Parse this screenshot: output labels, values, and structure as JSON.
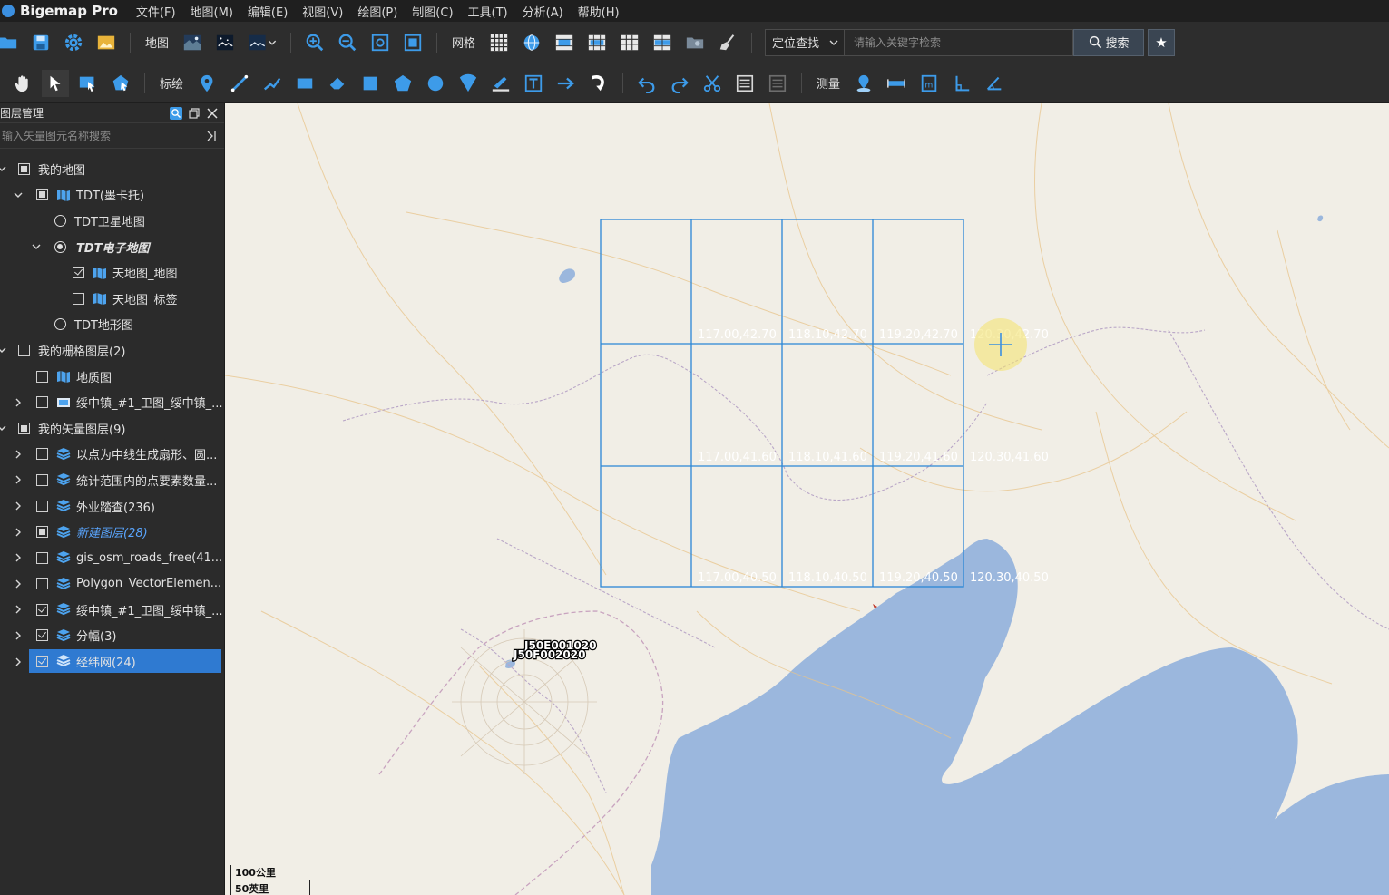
{
  "app": {
    "title": "Bigemap Pro",
    "menus": [
      "文件(F)",
      "地图(M)",
      "编辑(E)",
      "视图(V)",
      "绘图(P)",
      "制图(C)",
      "工具(T)",
      "分析(A)",
      "帮助(H)"
    ]
  },
  "toolbar1": {
    "map_label": "地图",
    "grid_label": "网格",
    "locate_label": "定位查找",
    "search_placeholder": "请输入关键字检索",
    "search_label": "搜索",
    "accent": "#3a4552"
  },
  "toolbar2": {
    "draw_label": "标绘",
    "measure_label": "测量"
  },
  "panel": {
    "title": "图层管理",
    "search_placeholder": "输入矢量图元名称搜索"
  },
  "layers": {
    "my_map": "我的地图",
    "tdt": "TDT(墨卡托)",
    "tdt_sat": "TDT卫星地图",
    "tdt_elec": "TDT电子地图",
    "tdt_map": "天地图_地图",
    "tdt_label": "天地图_标签",
    "tdt_terrain": "TDT地形图",
    "raster_group": "我的栅格图层(2)",
    "geology": "地质图",
    "suizhong_raster": "绥中镇_#1_卫图_绥中镇_...",
    "vector_group": "我的矢量图层(9)",
    "sector": "以点为中线生成扇形、圆...",
    "stats": "统计范围内的点要素数量...",
    "survey": "外业踏查(236)",
    "new_layer": "新建图层(28)",
    "osm_roads": "gis_osm_roads_free(41...",
    "polygon": "Polygon_VectorElemen...",
    "suizhong_vec": "绥中镇_#1_卫图_绥中镇_...",
    "sheets": "分幅(3)",
    "graticule": "经纬网(24)"
  },
  "map": {
    "grid_labels": {
      "r1": [
        "117.00,42.70",
        "118.10,42.70",
        "119.20,42.70",
        "120.30,42.70"
      ],
      "r2": [
        "117.00,41.60",
        "118.10,41.60",
        "119.20,41.60",
        "120.30,41.60"
      ],
      "r3": [
        "117.00,40.50",
        "118.10,40.50",
        "119.20,40.50",
        "120.30,40.50"
      ]
    },
    "sheet_code_1": "J50E001020",
    "sheet_code_2": "J50F002020",
    "scale_km": "100公里",
    "scale_mi": "50英里",
    "grid_color": "#2a86d6",
    "water_color": "#9bb7dd"
  }
}
